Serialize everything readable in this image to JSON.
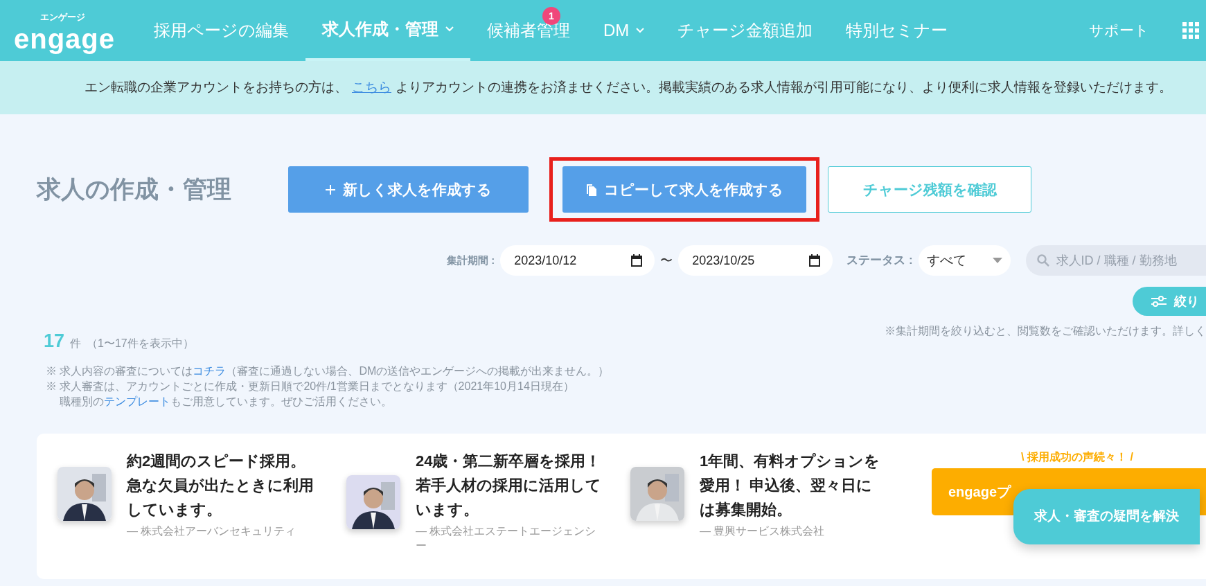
{
  "header": {
    "logo_caption": "エンゲージ",
    "logo": "engage",
    "nav": [
      {
        "label": "採用ページの編集",
        "selected": false,
        "dropdown": false
      },
      {
        "label": "求人作成・管理",
        "selected": true,
        "dropdown": true
      },
      {
        "label": "候補者管理",
        "selected": false,
        "dropdown": false,
        "badge": "1"
      },
      {
        "label": "DM",
        "selected": false,
        "dropdown": true
      },
      {
        "label": "チャージ金額追加",
        "selected": false,
        "dropdown": false
      },
      {
        "label": "特別セミナー",
        "selected": false,
        "dropdown": false
      }
    ],
    "support": "サポート"
  },
  "notice": {
    "before": "エン転職の企業アカウントをお持ちの方は、",
    "link": "こちら",
    "after": "よりアカウントの連携をお済ませください。掲載実績のある求人情報が引用可能になり、より便利に求人情報を登録いただけます。"
  },
  "page_title": "求人の作成・管理",
  "actions": [
    {
      "label": "新しく求人を作成する",
      "kind": "new",
      "highlighted": false
    },
    {
      "label": "コピーして求人を作成する",
      "kind": "copy",
      "highlighted": true
    },
    {
      "label": "チャージ残額を確認",
      "kind": "outline",
      "highlighted": false
    }
  ],
  "filters": {
    "period_label": "集計期間 :",
    "date_from": "2023/10/12",
    "separator": "〜",
    "date_to": "2023/10/25",
    "status_label": "ステータス :",
    "status_value": "すべて",
    "search_placeholder": "求人ID / 職種 / 勤務地",
    "filter_button": "絞り"
  },
  "period_note": "※集計期間を絞り込むと、閲覧数をご確認いただけます。詳しく",
  "count": {
    "number": "17",
    "unit": "件",
    "range": "（1〜17件を表示中）"
  },
  "notes": [
    {
      "before": "※ 求人内容の審査については",
      "link": "コチラ",
      "after": "（審査に通過しない場合、DMの送信やエンゲージへの掲載が出来ません。）",
      "indented": false
    },
    {
      "before": "※ 求人審査は、アカウントごとに作成・更新日順で20件/1営業日までとなります（2021年10月14日現在）",
      "indented": false
    },
    {
      "before": "職種別の",
      "link": "テンプレート",
      "after": "もご用意しています。ぜひご活用ください。",
      "indented": true
    }
  ],
  "testimonials": [
    {
      "quote": "約2週間のスピード採用。急な欠員が出たときに利用しています。",
      "company": "— 株式会社アーバンセキュリティ"
    },
    {
      "quote": "24歳・第二新卒層を採用！若手人材の採用に活用しています。",
      "company": "— 株式会社エステートエージェンシー"
    },
    {
      "quote": "1年間、有料オプションを愛用！ 申込後、翌々日には募集開始。",
      "company": "— 豊興サービス株式会社"
    }
  ],
  "promo": {
    "tagline": "\\ 採用成功の声続々！ /",
    "button": "engageプ"
  },
  "chat_button": "求人・審査の疑問を解決"
}
